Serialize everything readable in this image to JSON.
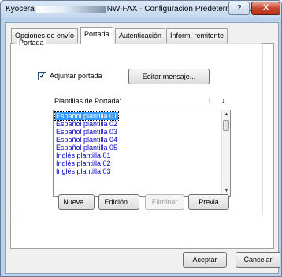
{
  "window": {
    "title_prefix": "Kyocera",
    "title_main": "NW-FAX - Configuración Predeterminada",
    "help_glyph": "?",
    "close_glyph": "X"
  },
  "tabs": [
    {
      "label": "Opciones de envío",
      "active": false
    },
    {
      "label": "Portada",
      "active": true
    },
    {
      "label": "Autenticación",
      "active": false
    },
    {
      "label": "Inform. remitente",
      "active": false
    }
  ],
  "portada": {
    "group_label": "Portada",
    "attach_checkbox": {
      "label": "Adjuntar portada",
      "checked": true,
      "glyph": "✓"
    },
    "edit_message_button": "Editar mensaje...",
    "templates_label": "Plantillas de Portada:",
    "sort_up_glyph": "↑",
    "sort_down_glyph": "↓",
    "templates": [
      "Español plantilla 01",
      "Español plantilla 02",
      "Español plantilla 03",
      "Español plantilla 04",
      "Español plantilla 05",
      "Inglés plantilla 01",
      "Inglés plantilla 02",
      "Inglés plantilla 03"
    ],
    "selected_index": 0,
    "buttons": {
      "new": "Nueva...",
      "edit": "Edición...",
      "delete": "Eliminar",
      "preview": "Previa"
    }
  },
  "footer": {
    "accept": "Aceptar",
    "cancel": "Cancelar"
  },
  "colors": {
    "list_text": "#0000c8",
    "selection": "#3399ff",
    "close_button": "#c7452d"
  }
}
